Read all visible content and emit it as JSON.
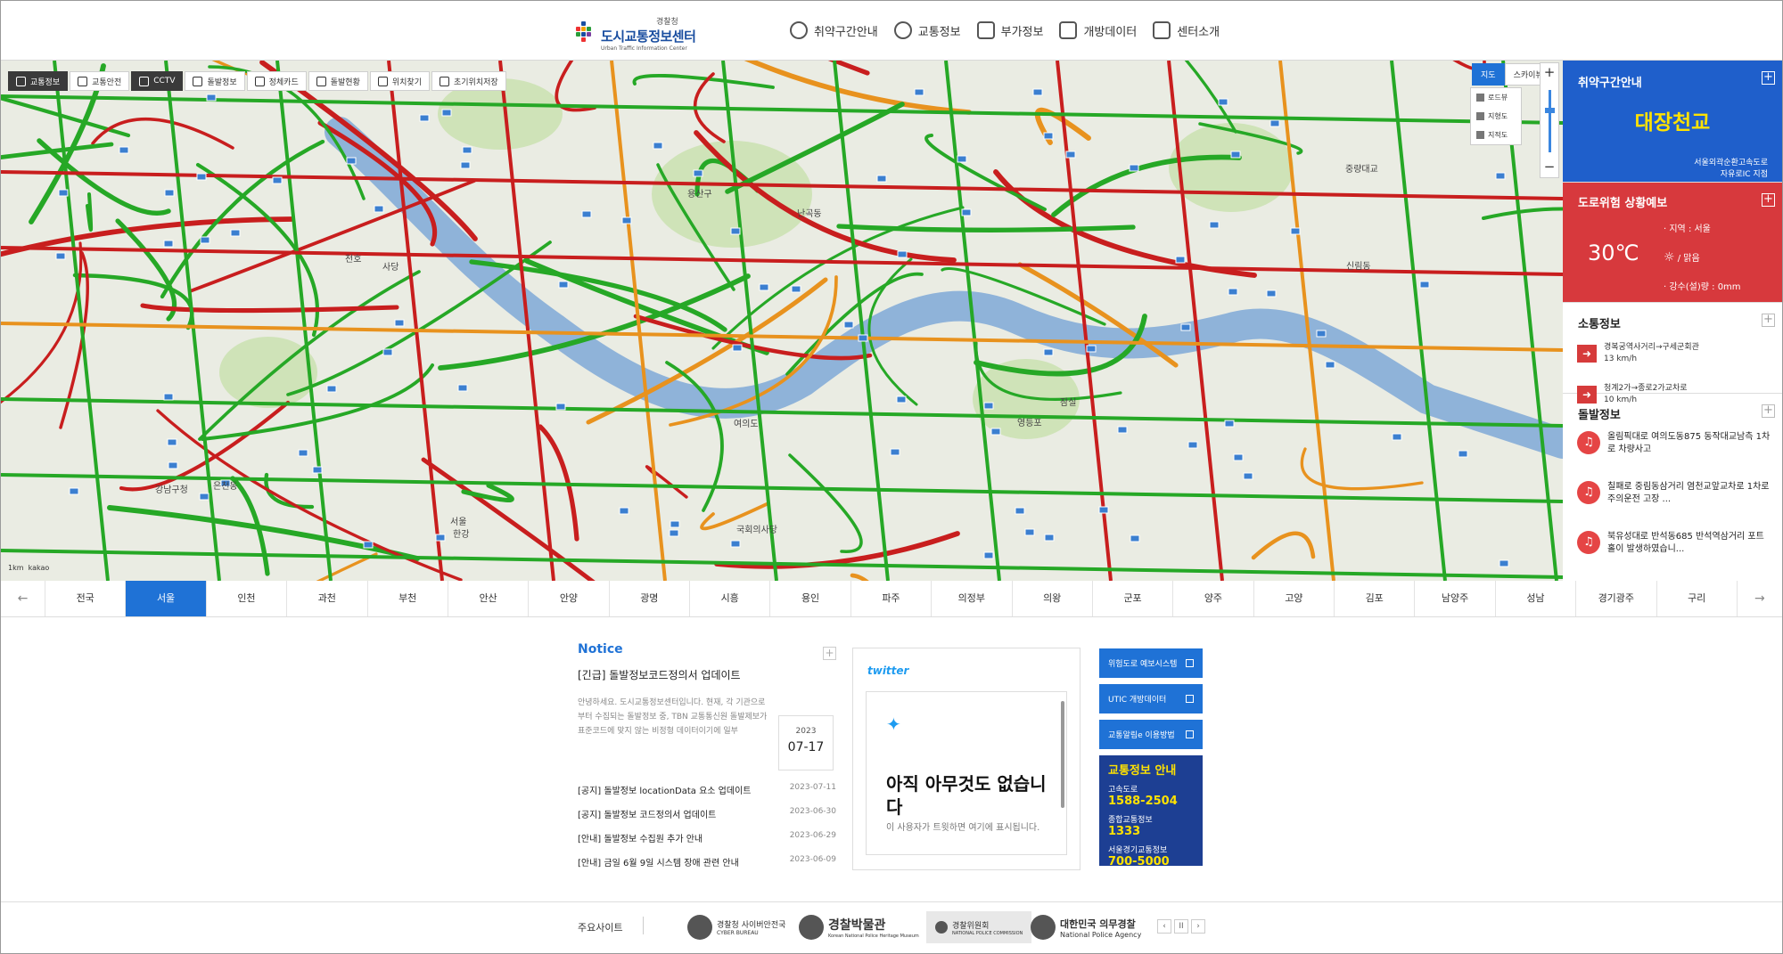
{
  "header": {
    "logo_top": "경찰청",
    "logo_title": "도시교통정보센터",
    "logo_sub": "Urban Traffic Information Center",
    "menu": [
      {
        "label": "취약구간안내",
        "icon": "route-icon"
      },
      {
        "label": "교통정보",
        "icon": "gauge-icon"
      },
      {
        "label": "부가정보",
        "icon": "clipboard-icon"
      },
      {
        "label": "개방데이터",
        "icon": "utic-data-icon"
      },
      {
        "label": "센터소개",
        "icon": "building-icon"
      }
    ]
  },
  "map": {
    "tools": [
      {
        "label": "교통정보",
        "dark": true,
        "icon": "road-icon"
      },
      {
        "label": "교통안전",
        "dark": false,
        "icon": "hatch-icon"
      },
      {
        "label": "CCTV",
        "dark": true,
        "icon": "cctv-icon"
      },
      {
        "label": "돌발정보",
        "dark": false,
        "icon": "warning-icon"
      },
      {
        "label": "정체카드",
        "dark": false,
        "icon": "car-icon"
      },
      {
        "label": "돌발현황",
        "dark": false,
        "icon": "alert-icon"
      },
      {
        "label": "위치찾기",
        "dark": false,
        "icon": "locate-icon"
      },
      {
        "label": "초기위치저장",
        "dark": false,
        "icon": "save-icon"
      }
    ],
    "map_type": [
      "지도",
      "스카이뷰"
    ],
    "layers": [
      "로드뷰",
      "지형도",
      "지적도"
    ],
    "scale": "1km",
    "provider": "kakao",
    "labels": [
      "서울",
      "용산구",
      "여의도",
      "한강",
      "국회의사당",
      "중량대교",
      "잠실",
      "강남구청",
      "영등포",
      "신림동",
      "난곡동",
      "은천동",
      "사당",
      "천호"
    ],
    "colors": {
      "green": "#26a826",
      "red": "#c81e1e",
      "orange": "#e8921e",
      "river": "#8fb3d9",
      "land": "#eaece3"
    }
  },
  "sidebar": {
    "vuln": {
      "title": "취약구간안내",
      "name": "대장천교",
      "line1": "서울외곽순환고속도로",
      "line2": "자유로IC 지점"
    },
    "risk": {
      "title": "도로위험 상황예보",
      "temp": "30℃",
      "region": "지역 : 서울",
      "weather": "/ 맑음",
      "rain": "강수(설)량 : 0mm"
    },
    "traffic": {
      "title": "소통정보",
      "items": [
        {
          "route": "경복궁역사거리→구세군회관",
          "speed": "13 km/h"
        },
        {
          "route": "청계2가→종로2가교차로",
          "speed": "10 km/h"
        }
      ]
    },
    "accident": {
      "title": "돌발정보",
      "items": [
        "올림픽대로 여의도동875 동작대교남측 1차로 차량사고",
        "칠패로 중림동삼거리 염천교앞교차로 1차로 주의운전 고장 ...",
        "북유성대로 반석동685 반석역삼거리 포트홀이 발생하였습니..."
      ]
    }
  },
  "regions": {
    "prev": "←",
    "next": "→",
    "active": 1,
    "items": [
      "전국",
      "서울",
      "인천",
      "과천",
      "부천",
      "안산",
      "안양",
      "광명",
      "시흥",
      "용인",
      "파주",
      "의정부",
      "의왕",
      "군포",
      "양주",
      "고양",
      "김포",
      "남양주",
      "성남",
      "경기광주",
      "구리"
    ]
  },
  "notice": {
    "title": "Notice",
    "headline": "[긴급] 돌발정보코드정의서 업데이트",
    "body": "안녕하세요. 도시교통정보센터입니다. 현재, 각 기관으로부터 수집되는 돌발정보 중, TBN 교통통신원 돌발제보가 표준코드에 맞지 않는 비정형 데이터이기에 일부",
    "year": "2023",
    "day": "07-17",
    "list": [
      {
        "title": "[공지] 돌발정보 locationData 요소 업데이트",
        "date": "2023-07-11"
      },
      {
        "title": "[공지] 돌발정보 코드정의서 업데이트",
        "date": "2023-06-30"
      },
      {
        "title": "[안내] 돌발정보 수집원 추가 안내",
        "date": "2023-06-29"
      },
      {
        "title": "[안내] 금일 6월 9일 시스템 장애 관련 안내",
        "date": "2023-06-09"
      }
    ]
  },
  "twitter": {
    "brand": "twitter",
    "empty_title": "아직 아무것도 없습니다",
    "empty_sub": "이 사용자가 트윗하면 여기에 표시됩니다."
  },
  "quick": {
    "buttons": [
      "위험도로 예보시스템",
      "UTIC 개방데이터",
      "교통알림e 이용방법"
    ],
    "banner": {
      "title": "교통정보 안내",
      "lines": [
        {
          "label": "고속도로",
          "number": "1588-2504"
        },
        {
          "label": "종합교통정보",
          "number": "1333"
        },
        {
          "label": "서울경기교통정보",
          "number": "700-5000"
        }
      ]
    }
  },
  "footer": {
    "label": "주요사이트",
    "sites": [
      {
        "name": "경찰청 사이버안전국",
        "tag": "CYBER BUREAU"
      },
      {
        "name": "경찰박물관",
        "tag": "Korean National Police Heritage Museum"
      },
      {
        "name": "경찰위원회",
        "tag": "NATIONAL POLICE COMMISSION"
      },
      {
        "name": "대한민국 의무경찰",
        "tag": "National Police Agency"
      }
    ],
    "controls": [
      "‹",
      "II",
      "›"
    ]
  }
}
